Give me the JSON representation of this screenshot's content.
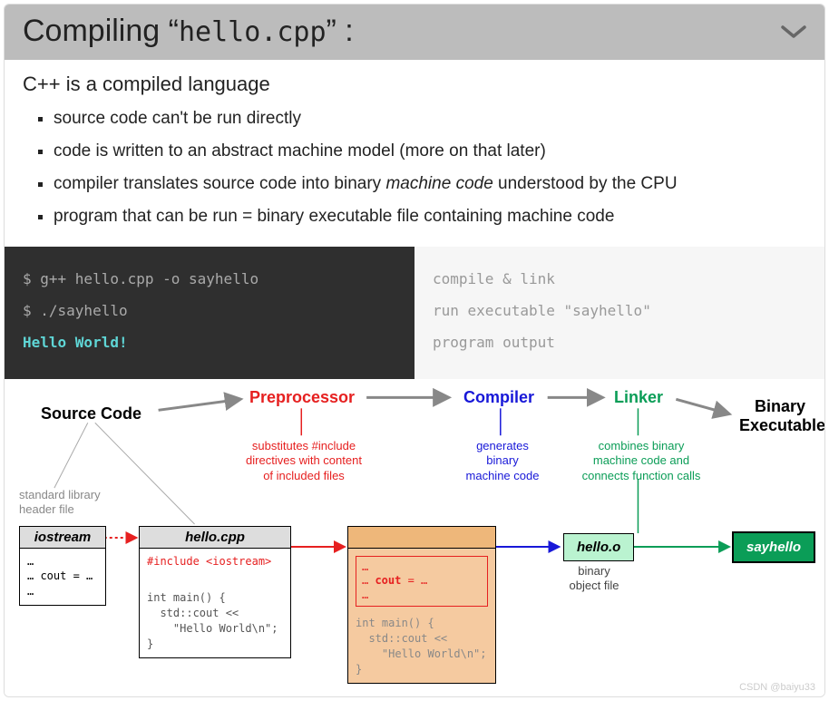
{
  "header": {
    "title_prefix": "Compiling “",
    "title_filename": "hello.cpp",
    "title_suffix": "” :"
  },
  "subtitle": "C++ is a compiled language",
  "bullets": [
    "source code can't be run directly",
    "code is written to an abstract machine model (more on that later)",
    "compiler translates source code into binary <i>machine code</i> understood by the CPU",
    "program that can be run = binary executable file containing machine code"
  ],
  "terminal": {
    "lines": [
      {
        "text": "$ g++ hello.cpp -o sayhello",
        "cls": "prompt"
      },
      {
        "text": "$ ./sayhello",
        "cls": "prompt"
      },
      {
        "text": "Hello World!",
        "cls": "out"
      }
    ]
  },
  "explain": [
    "compile & link",
    "run executable \"sayhello\"",
    "program output"
  ],
  "stages": {
    "source": "Source Code",
    "preproc": "Preprocessor",
    "compiler": "Compiler",
    "linker": "Linker",
    "binary": "Binary Executable"
  },
  "desc": {
    "preproc": "substitutes #include\ndirectives with content\nof included files",
    "compiler": "generates\nbinary\nmachine code",
    "linker": "combines binary\nmachine code and\nconnects function calls"
  },
  "files": {
    "iostream": {
      "title": "iostream",
      "body": "…\n… cout = …\n…"
    },
    "hello": {
      "title": "hello.cpp",
      "includeLine": "#include <iostream>",
      "body": "int main() {\n  std::cout <<\n    \"Hello World\\n\";\n}"
    },
    "processed": {
      "redBody": "…\n… cout = …\n…",
      "body": "int main() {\n  std::cout <<\n    \"Hello World\\n\";\n}"
    },
    "obj": {
      "title": "hello.o",
      "label": "binary\nobject file"
    },
    "exe": {
      "title": "sayhello"
    },
    "hdrLabel": "standard library\nheader file"
  },
  "watermark": "CSDN @baiyu33"
}
